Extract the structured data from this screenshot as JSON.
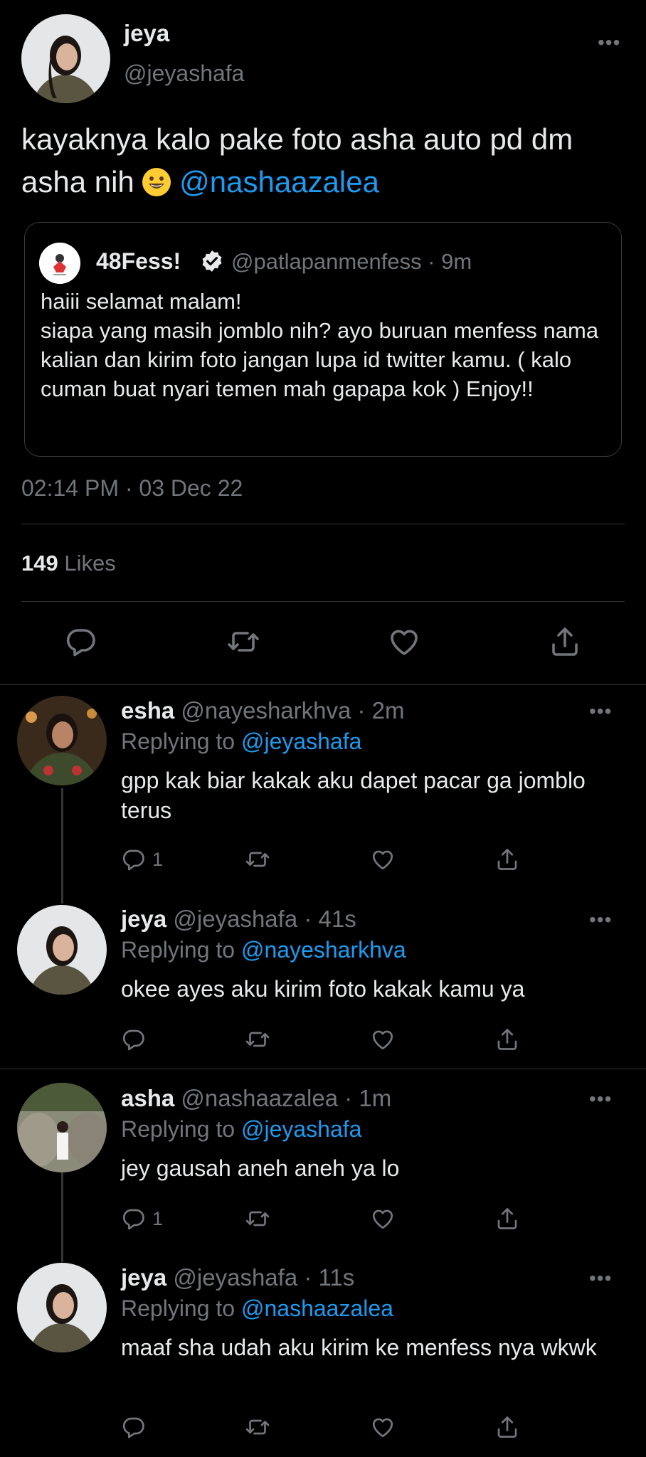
{
  "main": {
    "name": "jeya",
    "handle": "@jeyashafa",
    "text_before": "kayaknya kalo pake foto asha auto pd dm asha nih ",
    "mention": "@nashaazalea",
    "timestamp": "02:14 PM · 03 Dec 22",
    "likes_count": "149",
    "likes_label": "Likes",
    "quote": {
      "name": "48Fess!",
      "handle_time": "@patlapanmenfess · 9m",
      "text": "haiii selamat malam!\nsiapa yang masih jomblo nih? ayo buruan menfess nama kalian dan kirim foto jangan lupa id twitter kamu. ( kalo cuman buat nyari temen mah gapapa kok ) Enjoy!!"
    }
  },
  "replies": [
    {
      "name": "esha",
      "meta": "@nayesharkhva · 2m",
      "replying_label": "Replying to",
      "replying_to": "@jeyashafa",
      "text": "gpp kak biar kakak aku dapet pacar ga jomblo terus",
      "reply_count": "1"
    },
    {
      "name": "jeya",
      "meta": "@jeyashafa · 41s",
      "replying_label": "Replying to",
      "replying_to": "@nayesharkhva",
      "text": "okee ayes aku kirim foto kakak kamu ya",
      "reply_count": ""
    },
    {
      "name": "asha",
      "meta": "@nashaazalea · 1m",
      "replying_label": "Replying to",
      "replying_to": "@jeyashafa",
      "text": "jey gausah aneh aneh ya lo",
      "reply_count": "1"
    },
    {
      "name": "jeya",
      "meta": "@jeyashafa · 11s",
      "replying_label": "Replying to",
      "replying_to": "@nashaazalea",
      "text": "maaf sha udah aku kirim ke menfess nya wkwk",
      "reply_count": ""
    }
  ],
  "icons": {
    "reply": "reply-icon",
    "retweet": "retweet-icon",
    "like": "heart-icon",
    "share": "share-icon",
    "more": "more-icon"
  },
  "colors": {
    "background": "#000000",
    "text": "#e7e9ea",
    "secondary": "#71767b",
    "link": "#1d9bf0",
    "divider": "#2f3336"
  }
}
